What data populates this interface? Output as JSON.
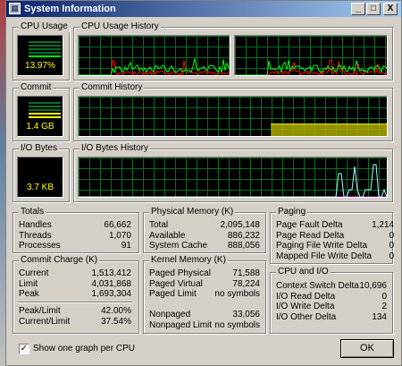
{
  "window": {
    "title": "System Information"
  },
  "caption_buttons": {
    "minimize": "_",
    "maximize": "□",
    "close": "X"
  },
  "cpu": {
    "label": "CPU Usage",
    "value": "13.97%",
    "history_label": "CPU Usage History",
    "level": 0.14
  },
  "commit": {
    "label": "Commit",
    "value": "1.4 GB",
    "history_label": "Commit History",
    "level": 0.35
  },
  "io": {
    "label": "I/O Bytes",
    "value": "3.7  KB",
    "history_label": "I/O Bytes History",
    "level": 0.02
  },
  "totals": {
    "title": "Totals",
    "rows": [
      {
        "k": "Handles",
        "v": "66,662"
      },
      {
        "k": "Threads",
        "v": "1,070"
      },
      {
        "k": "Processes",
        "v": "91"
      }
    ]
  },
  "physical_memory": {
    "title": "Physical Memory (K)",
    "rows": [
      {
        "k": "Total",
        "v": "2,095,148"
      },
      {
        "k": "Available",
        "v": "886,232"
      },
      {
        "k": "System Cache",
        "v": "888,056"
      }
    ]
  },
  "paging": {
    "title": "Paging",
    "rows": [
      {
        "k": "Page Fault Delta",
        "v": "1,214"
      },
      {
        "k": "Page Read Delta",
        "v": "0"
      },
      {
        "k": "Paging File Write Delta",
        "v": "0"
      },
      {
        "k": "Mapped File Write Delta",
        "v": "0"
      }
    ]
  },
  "commit_charge": {
    "title": "Commit Charge (K)",
    "rows": [
      {
        "k": "Current",
        "v": "1,513,412"
      },
      {
        "k": "Limit",
        "v": "4,031,868"
      },
      {
        "k": "Peak",
        "v": "1,693,304"
      }
    ],
    "ratios": [
      {
        "k": "Peak/Limit",
        "v": "42.00%"
      },
      {
        "k": "Current/Limit",
        "v": "37.54%"
      }
    ]
  },
  "kernel_memory": {
    "title": "Kernel Memory (K)",
    "rows": [
      {
        "k": "Paged Physical",
        "v": "71,588"
      },
      {
        "k": "Paged Virtual",
        "v": "78,224"
      },
      {
        "k": "Paged Limit",
        "v": "no symbols"
      }
    ],
    "rows2": [
      {
        "k": "Nonpaged",
        "v": "33,056"
      },
      {
        "k": "Nonpaged Limit",
        "v": "no symbols"
      }
    ]
  },
  "cpu_io": {
    "title": "CPU and I/O",
    "rows": [
      {
        "k": "Context Switch Delta",
        "v": "10,696"
      },
      {
        "k": "I/O Read Delta",
        "v": "0"
      },
      {
        "k": "I/O Write Delta",
        "v": "2"
      },
      {
        "k": "I/O Other Delta",
        "v": "134"
      }
    ]
  },
  "options": {
    "per_cpu_label": "Show one graph per CPU",
    "per_cpu_checked": true,
    "check_mark": "✓"
  },
  "ok_label": "OK",
  "colors": {
    "grid": "#0a6e2a",
    "cpu_line": "#00ff00",
    "kernel_line": "#ff0000",
    "commit_fill": "#aaaa00",
    "io_line": "#a0ffff",
    "io_write": "#ff00ff"
  }
}
